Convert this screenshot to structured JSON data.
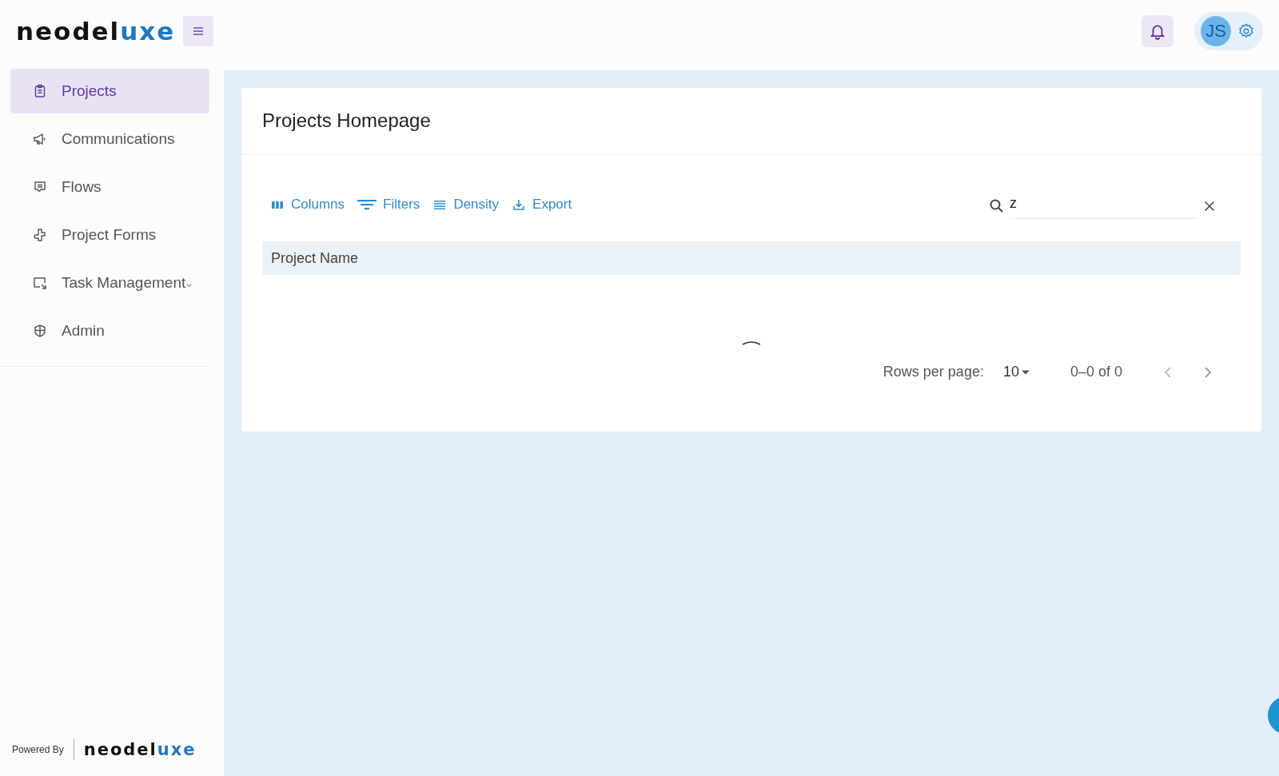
{
  "header": {
    "logo": [
      {
        "text": "neodel",
        "accent": false
      },
      {
        "text": "uxe",
        "accent": true
      }
    ],
    "user_initials": "JS"
  },
  "sidebar": {
    "items": [
      {
        "label": "Projects",
        "selected": true,
        "expandable": false
      },
      {
        "label": "Communications",
        "selected": false,
        "expandable": false
      },
      {
        "label": "Flows",
        "selected": false,
        "expandable": false
      },
      {
        "label": "Project Forms",
        "selected": false,
        "expandable": false
      },
      {
        "label": "Task Management",
        "selected": false,
        "expandable": true
      },
      {
        "label": "Admin",
        "selected": false,
        "expandable": false
      }
    ],
    "footer": {
      "powered_by": "Powered By",
      "logo": [
        {
          "text": "neodel",
          "accent": false
        },
        {
          "text": "uxe",
          "accent": true
        }
      ]
    }
  },
  "card": {
    "title": "Projects Homepage",
    "toolbar": [
      {
        "label": "Columns"
      },
      {
        "label": "Filters"
      },
      {
        "label": "Density"
      },
      {
        "label": "Export"
      }
    ],
    "search": {
      "value": "z"
    },
    "table": {
      "columns": [
        "Project Name"
      ],
      "loading": true
    },
    "pagination": {
      "rows_per_page_label": "Rows per page:",
      "rows_per_page": "10",
      "range": "0–0 of 0"
    }
  }
}
